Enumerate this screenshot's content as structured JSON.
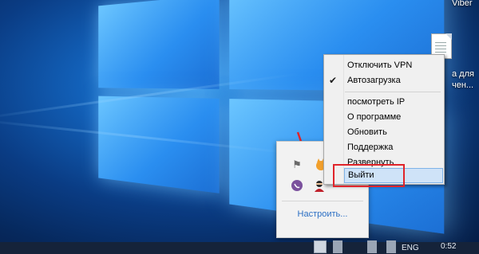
{
  "desktop": {
    "top_right_label": "Viber",
    "file_label_line1": "а для",
    "file_label_line2": "чен..."
  },
  "tray_popup": {
    "configure_label": "Настроить...",
    "icons": [
      "flag-icon",
      "cat-avatar-icon",
      "viber-icon",
      "vpn-ninja-icon"
    ]
  },
  "context_menu": {
    "items": [
      {
        "label": "Отключить VPN",
        "checked": false
      },
      {
        "label": "Автозагрузка",
        "checked": true
      },
      {
        "label": "посмотреть IP",
        "checked": false
      },
      {
        "label": "О программе",
        "checked": false
      },
      {
        "label": "Обновить",
        "checked": false
      },
      {
        "label": "Поддержка",
        "checked": false
      },
      {
        "label": "Развернуть",
        "checked": false
      },
      {
        "label": "Выйти",
        "checked": false,
        "highlighted": true
      }
    ]
  },
  "taskbar": {
    "lang": "ENG",
    "time": "0:52"
  },
  "colors": {
    "highlight": "#cfe3f8",
    "annotation_red": "#e0242a",
    "link_blue": "#2b6fc4"
  }
}
